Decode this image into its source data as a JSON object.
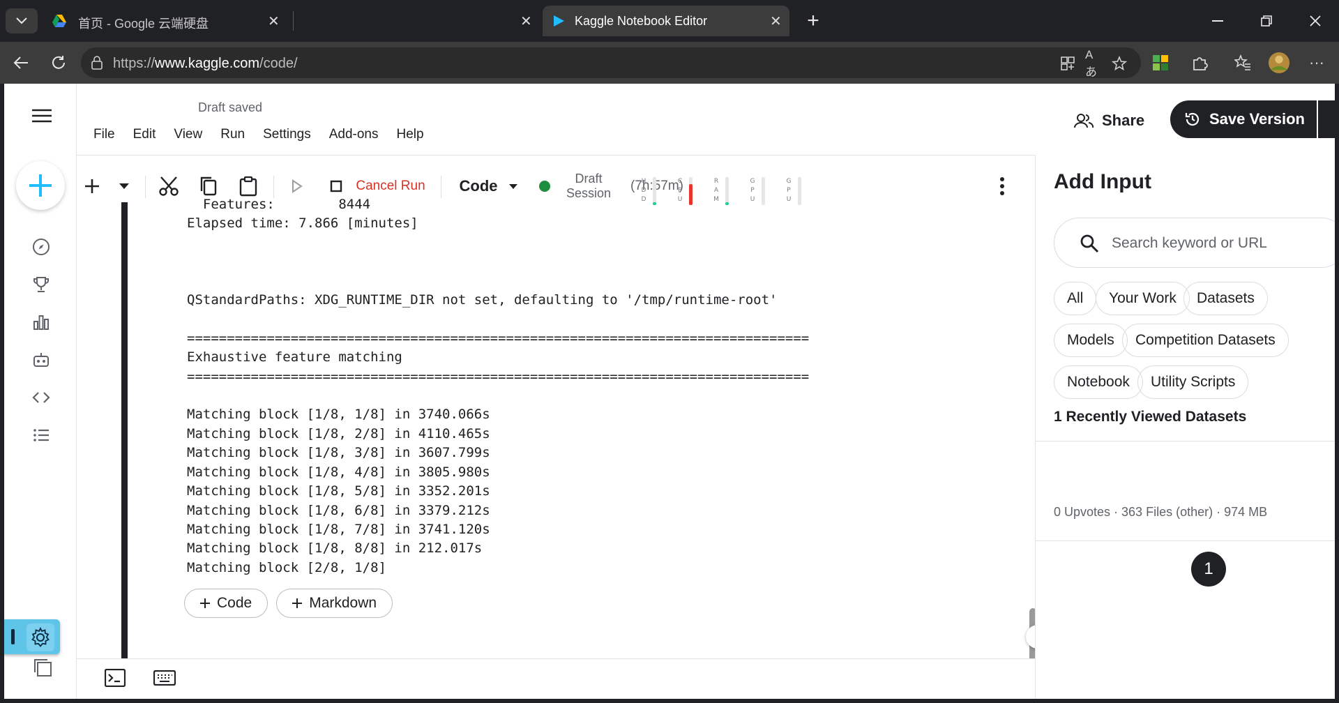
{
  "browser": {
    "tabs": [
      {
        "title": "首页 - Google 云端硬盘",
        "active": false
      },
      {
        "title": "",
        "active": false
      },
      {
        "title": "Kaggle Notebook Editor",
        "active": true
      }
    ],
    "url_scheme": "https://",
    "url_host": "www.kaggle.com",
    "url_path": "/code/"
  },
  "editor": {
    "status": "Draft saved",
    "menu": [
      "File",
      "Edit",
      "View",
      "Run",
      "Settings",
      "Add-ons",
      "Help"
    ],
    "share_label": "Share",
    "save_label": "Save Version",
    "toolbar": {
      "cancel_run": "Cancel Run",
      "cell_type": "Code",
      "session_line1": "Draft",
      "session_line2": "Session",
      "timer": "(7h:57m)",
      "meters": [
        {
          "label": [
            "H",
            "D",
            "D"
          ],
          "level": 0.1,
          "color": "#20c997"
        },
        {
          "label": [
            "C",
            "P",
            "U"
          ],
          "level": 0.75,
          "color": "#e8342a"
        },
        {
          "label": [
            "R",
            "A",
            "M"
          ],
          "level": 0.1,
          "color": "#20c997"
        },
        {
          "label": [
            "G",
            "P",
            "U"
          ],
          "level": 0,
          "color": "#20c997"
        },
        {
          "label": [
            "G",
            "P",
            "U"
          ],
          "level": 0,
          "color": "#20c997"
        }
      ]
    },
    "output_lines": [
      "  Features:        8444",
      "Elapsed time: 7.866 [minutes]",
      "",
      "",
      "",
      "QStandardPaths: XDG_RUNTIME_DIR not set, defaulting to '/tmp/runtime-root'",
      "",
      "==============================================================================",
      "Exhaustive feature matching",
      "==============================================================================",
      "",
      "Matching block [1/8, 1/8] in 3740.066s",
      "Matching block [1/8, 2/8] in 4110.465s",
      "Matching block [1/8, 3/8] in 3607.799s",
      "Matching block [1/8, 4/8] in 3805.980s",
      "Matching block [1/8, 5/8] in 3352.201s",
      "Matching block [1/8, 6/8] in 3379.212s",
      "Matching block [1/8, 7/8] in 3741.120s",
      "Matching block [1/8, 8/8] in 212.017s",
      "Matching block [2/8, 1/8]"
    ],
    "add_code_label": "Code",
    "add_markdown_label": "Markdown"
  },
  "right_panel": {
    "title": "Add Input",
    "search_placeholder": "Search keyword or URL",
    "chips": [
      "All",
      "Your Work",
      "Datasets",
      "Models",
      "Competition Datasets",
      "Notebook",
      "Utility Scripts"
    ],
    "recent_title": "1 Recently Viewed Datasets",
    "dataset_meta": "0 Upvotes · 363 Files (other) · 974 MB",
    "badge": "1"
  }
}
